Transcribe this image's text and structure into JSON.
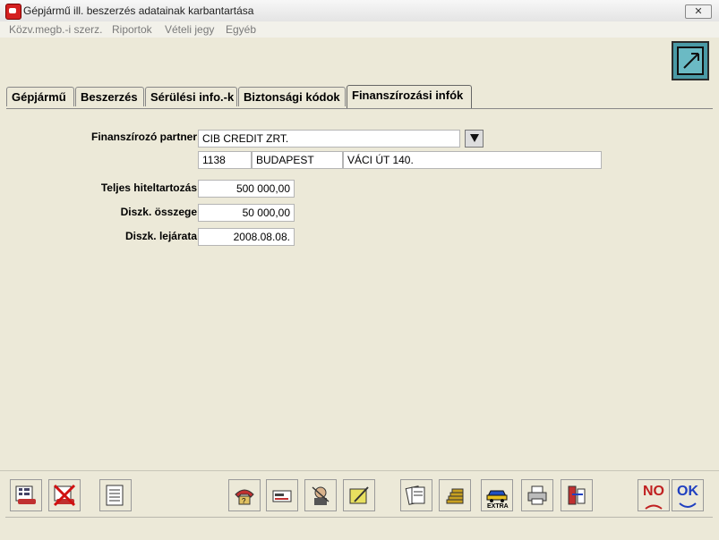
{
  "window": {
    "title": "Gépjármű ill. beszerzés adatainak karbantartása",
    "close_label": "✕"
  },
  "menu": {
    "items": [
      "Közv.megb.-i szerz.",
      "Riportok",
      "Vételi jegy",
      "Egyéb"
    ]
  },
  "tabs": [
    {
      "label": "Gépjármű"
    },
    {
      "label": "Beszerzés"
    },
    {
      "label": "Sérülési info.-k"
    },
    {
      "label": "Biztonsági kódok"
    },
    {
      "label": "Finanszírozási infók",
      "active": true
    }
  ],
  "form": {
    "partner_label": "Finanszírozó partner",
    "partner_name": "CIB CREDIT ZRT.",
    "zip": "1138",
    "city": "BUDAPEST",
    "address": "VÁCI ÚT 140.",
    "total_debt_label": "Teljes hiteltartozás",
    "total_debt": "500 000,00",
    "disc_amount_label": "Diszk. összege",
    "disc_amount": "50 000,00",
    "disc_expiry_label": "Diszk. lejárata",
    "disc_expiry": "2008.08.08."
  },
  "toolbar": {
    "no_label": "NO",
    "ok_label": "OK",
    "extra_label": "EXTRA"
  },
  "colors": {
    "window_bg": "#ece9d8",
    "accent_teal": "#4a9aa6",
    "no_red": "#c02020",
    "ok_blue": "#2040c0"
  }
}
